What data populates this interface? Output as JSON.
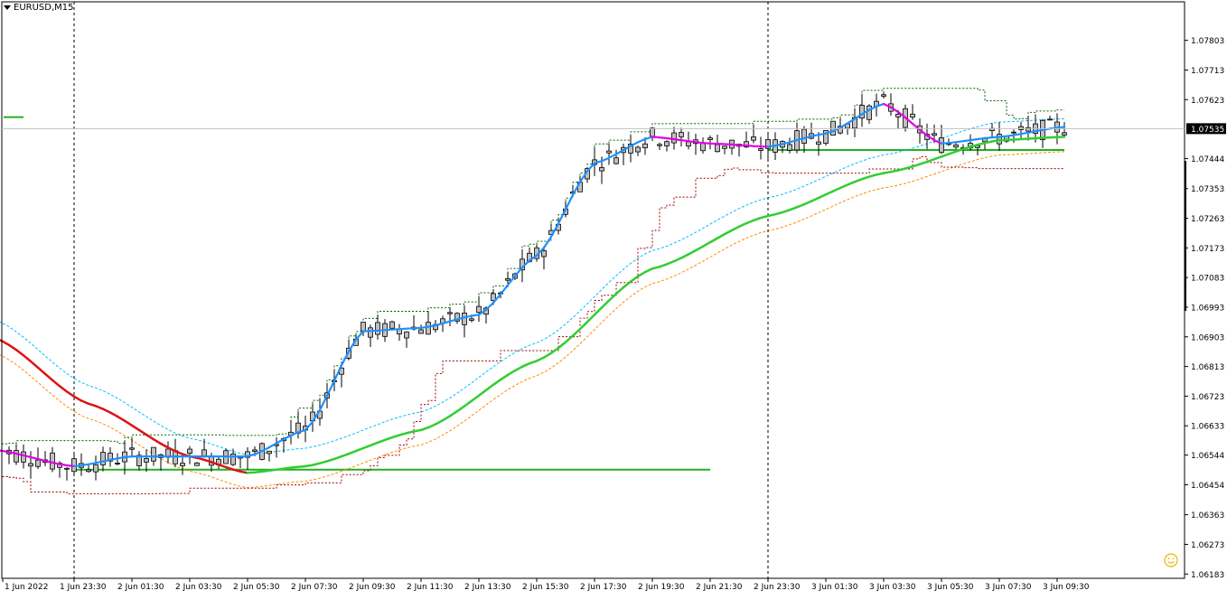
{
  "window": {
    "symbol_timeframe": "EURUSD,M15",
    "menu_icon": "triangle-down-icon",
    "expert_icon": "smiley-icon"
  },
  "colors": {
    "background": "#ffffff",
    "frame": "#000000",
    "candle_body": "#c0c0c0",
    "candle_wick": "#000000",
    "price_line": "#c0c0c0",
    "ma_rising": "#32cd32",
    "ma_falling": "#dc1414",
    "fast_ma_up": "#1e90ff",
    "fast_ma_down": "#e100e1",
    "envelope_upper": "#00bfff",
    "envelope_lower": "#ff8c00",
    "channel_high": "#006400",
    "channel_low": "#a00000",
    "level_line": "#22b022",
    "current_price_badge": "#000000"
  },
  "price_axis": {
    "labels": [
      "1.07803",
      "1.07713",
      "1.07623",
      "1.07535",
      "1.07444",
      "1.07353",
      "1.07263",
      "1.07173",
      "1.07083",
      "1.06993",
      "1.06903",
      "1.06813",
      "1.06723",
      "1.06633",
      "1.06544",
      "1.06454",
      "1.06363",
      "1.06273",
      "1.06183"
    ],
    "current_price": "1.07535",
    "min": 1.0617,
    "max": 1.0792
  },
  "time_axis": {
    "labels": [
      "1 Jun 2022",
      "1 Jun 23:30",
      "2 Jun 01:30",
      "2 Jun 03:30",
      "2 Jun 05:30",
      "2 Jun 07:30",
      "2 Jun 09:30",
      "2 Jun 11:30",
      "2 Jun 13:30",
      "2 Jun 15:30",
      "2 Jun 17:30",
      "2 Jun 19:30",
      "2 Jun 21:30",
      "2 Jun 23:30",
      "3 Jun 01:30",
      "3 Jun 03:30",
      "3 Jun 05:30",
      "3 Jun 07:30",
      "3 Jun 09:30"
    ]
  },
  "chart_data": {
    "type": "candlestick",
    "symbol": "EURUSD",
    "timeframe": "M15",
    "ylim": [
      1.0617,
      1.0792
    ],
    "current_price": 1.07535,
    "period_separators": [
      "1 Jun 23:30",
      "2 Jun 23:30"
    ],
    "horizontal_levels": [
      {
        "price": 1.0757,
        "from": "1 Jun 20:30",
        "to": "1 Jun 21:45"
      },
      {
        "price": 1.065,
        "from": "1 Jun 23:30",
        "to": "2 Jun 21:30"
      },
      {
        "price": 1.0747,
        "from": "2 Jun 23:30",
        "to": "3 Jun 09:45"
      }
    ],
    "slow_ma": [
      {
        "t": "1 Jun 20:45",
        "v": 1.069
      },
      {
        "t": "2 Jun 00:00",
        "v": 1.067
      },
      {
        "t": "2 Jun 03:30",
        "v": 1.0654
      },
      {
        "t": "2 Jun 05:30",
        "v": 1.0649
      },
      {
        "t": "2 Jun 07:30",
        "v": 1.0651
      },
      {
        "t": "2 Jun 11:30",
        "v": 1.0662
      },
      {
        "t": "2 Jun 15:30",
        "v": 1.0683
      },
      {
        "t": "2 Jun 19:30",
        "v": 1.0711
      },
      {
        "t": "2 Jun 23:30",
        "v": 1.0727
      },
      {
        "t": "3 Jun 03:30",
        "v": 1.074
      },
      {
        "t": "3 Jun 07:30",
        "v": 1.075
      },
      {
        "t": "3 Jun 09:45",
        "v": 1.0751
      }
    ],
    "fast_ma": [
      {
        "t": "1 Jun 20:45",
        "v": 1.0656
      },
      {
        "t": "1 Jun 23:30",
        "v": 1.0651
      },
      {
        "t": "2 Jun 01:30",
        "v": 1.0654
      },
      {
        "t": "2 Jun 05:30",
        "v": 1.0654
      },
      {
        "t": "2 Jun 07:30",
        "v": 1.0662
      },
      {
        "t": "2 Jun 09:30",
        "v": 1.0692
      },
      {
        "t": "2 Jun 11:30",
        "v": 1.0693
      },
      {
        "t": "2 Jun 13:30",
        "v": 1.0697
      },
      {
        "t": "2 Jun 15:30",
        "v": 1.0715
      },
      {
        "t": "2 Jun 17:30",
        "v": 1.0743
      },
      {
        "t": "2 Jun 19:30",
        "v": 1.0751
      },
      {
        "t": "2 Jun 21:30",
        "v": 1.0749
      },
      {
        "t": "2 Jun 23:30",
        "v": 1.0748
      },
      {
        "t": "3 Jun 01:30",
        "v": 1.0752
      },
      {
        "t": "3 Jun 03:30",
        "v": 1.0761
      },
      {
        "t": "3 Jun 05:30",
        "v": 1.0749
      },
      {
        "t": "3 Jun 07:30",
        "v": 1.0751
      },
      {
        "t": "3 Jun 09:45",
        "v": 1.0754
      }
    ]
  }
}
